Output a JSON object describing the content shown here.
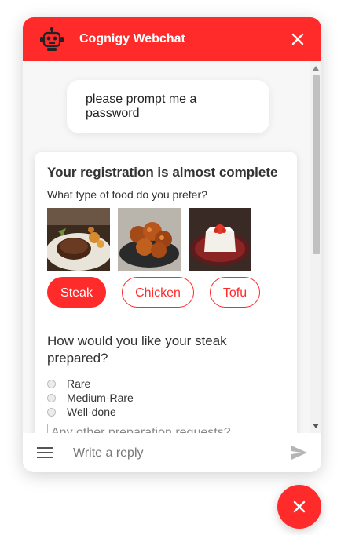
{
  "header": {
    "title": "Cognigy Webchat",
    "logo_icon": "robot-icon",
    "close_icon": "close-icon"
  },
  "messages": {
    "user_text": "please prompt me a password"
  },
  "form": {
    "title": "Your registration is almost complete",
    "food_question": "What type of food do you prefer?",
    "food_images": [
      "steak-photo",
      "chicken-photo",
      "tofu-photo"
    ],
    "choices": [
      {
        "label": "Steak",
        "selected": true
      },
      {
        "label": "Chicken",
        "selected": false
      },
      {
        "label": "Tofu",
        "selected": false
      }
    ],
    "steak_question": "How would you like your steak prepared?",
    "options": [
      "Rare",
      "Medium-Rare",
      "Well-done"
    ],
    "textarea_placeholder": "Any other preparation requests?"
  },
  "input": {
    "placeholder": "Write a reply",
    "menu_icon": "menu-icon",
    "send_icon": "send-icon"
  },
  "toggle": {
    "icon": "close-icon"
  },
  "colors": {
    "accent": "#ff2a2a",
    "background": "#f7f7f7"
  }
}
